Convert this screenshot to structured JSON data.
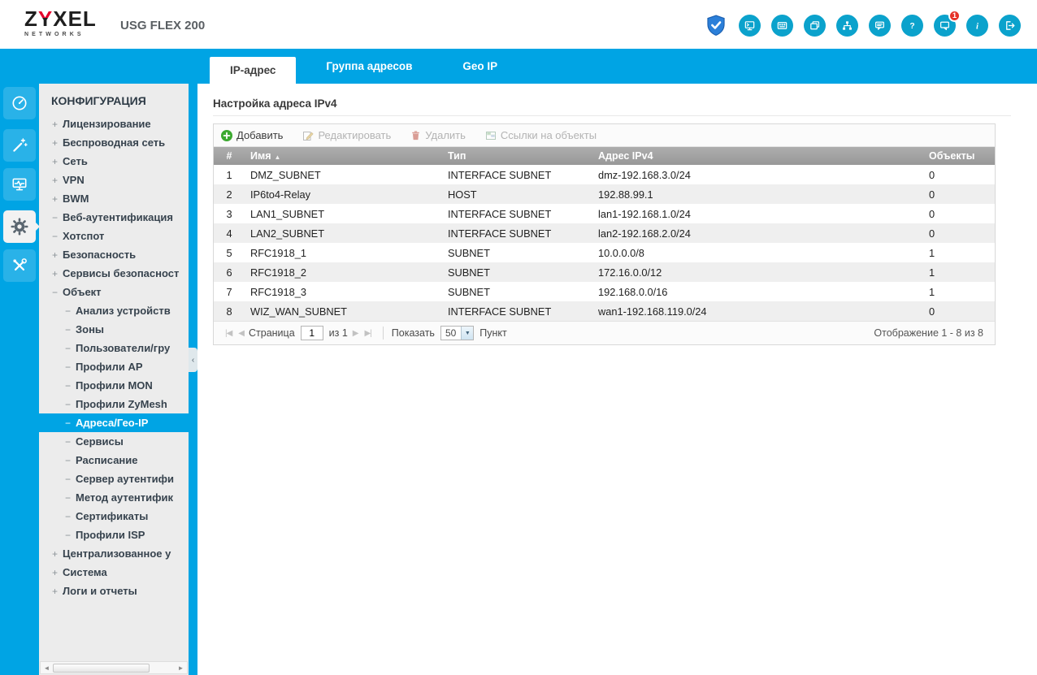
{
  "header": {
    "brand": {
      "z": "Z",
      "y": "Y",
      "rest": "XEL",
      "sub": "NETWORKS"
    },
    "product": "USG FLEX 200",
    "notification_badge": "1",
    "icon_names": [
      "shield-check-icon",
      "web-console-icon",
      "cli-icon",
      "reference-icon",
      "sitemap-icon",
      "forum-icon",
      "help-icon",
      "notification-icon",
      "info-icon",
      "logout-icon"
    ]
  },
  "colors": {
    "accent_cyan": "#00a4e4",
    "icon_teal": "#0ba2cc",
    "badge_red": "#e63329",
    "add_green": "#3ba92f"
  },
  "tabs": [
    {
      "label": "IP-адрес",
      "active": true
    },
    {
      "label": "Группа адресов",
      "active": false
    },
    {
      "label": "Geo IP",
      "active": false
    }
  ],
  "module_strip": {
    "icon_names": [
      "dashboard-icon",
      "wizard-icon",
      "monitor-icon",
      "configuration-gear-icon",
      "maintenance-icon"
    ],
    "active": "configuration-gear-icon"
  },
  "sidebar": {
    "title": "КОНФИГУРАЦИЯ",
    "items": [
      {
        "prefix": "+",
        "label": "Лицензирование",
        "level": 0,
        "active": false
      },
      {
        "prefix": "+",
        "label": "Беспроводная сеть",
        "level": 0,
        "active": false
      },
      {
        "prefix": "+",
        "label": "Сеть",
        "level": 0,
        "active": false
      },
      {
        "prefix": "+",
        "label": "VPN",
        "level": 0,
        "active": false
      },
      {
        "prefix": "+",
        "label": "BWM",
        "level": 0,
        "active": false
      },
      {
        "prefix": "−",
        "label": "Веб-аутентификация",
        "level": 0,
        "active": false
      },
      {
        "prefix": "−",
        "label": "Хотспот",
        "level": 0,
        "active": false
      },
      {
        "prefix": "+",
        "label": "Безопасность",
        "level": 0,
        "active": false
      },
      {
        "prefix": "+",
        "label": "Сервисы безопасност",
        "level": 0,
        "active": false
      },
      {
        "prefix": "−",
        "label": "Объект",
        "level": 0,
        "active": false
      },
      {
        "prefix": "−",
        "label": "Анализ устройств",
        "level": 1,
        "active": false
      },
      {
        "prefix": "−",
        "label": "Зоны",
        "level": 1,
        "active": false
      },
      {
        "prefix": "−",
        "label": "Пользователи/гру",
        "level": 1,
        "active": false
      },
      {
        "prefix": "−",
        "label": "Профили AP",
        "level": 1,
        "active": false
      },
      {
        "prefix": "−",
        "label": "Профили MON",
        "level": 1,
        "active": false
      },
      {
        "prefix": "−",
        "label": "Профили ZyMesh",
        "level": 1,
        "active": false
      },
      {
        "prefix": "−",
        "label": "Адреса/Гео-IP",
        "level": 1,
        "active": true
      },
      {
        "prefix": "−",
        "label": "Сервисы",
        "level": 1,
        "active": false
      },
      {
        "prefix": "−",
        "label": "Расписание",
        "level": 1,
        "active": false
      },
      {
        "prefix": "−",
        "label": "Сервер аутентифи",
        "level": 1,
        "active": false
      },
      {
        "prefix": "−",
        "label": "Метод аутентифик",
        "level": 1,
        "active": false
      },
      {
        "prefix": "−",
        "label": "Сертификаты",
        "level": 1,
        "active": false
      },
      {
        "prefix": "−",
        "label": "Профили ISP",
        "level": 1,
        "active": false
      },
      {
        "prefix": "+",
        "label": "Централизованное у",
        "level": 0,
        "active": false
      },
      {
        "prefix": "+",
        "label": "Система",
        "level": 0,
        "active": false
      },
      {
        "prefix": "+",
        "label": "Логи и отчеты",
        "level": 0,
        "active": false
      }
    ]
  },
  "main": {
    "section_title": "Настройка адреса IPv4",
    "toolbar": [
      {
        "label": "Добавить",
        "enabled": true,
        "icon": "add-plus-icon"
      },
      {
        "label": "Редактировать",
        "enabled": false,
        "icon": "edit-pencil-icon"
      },
      {
        "label": "Удалить",
        "enabled": false,
        "icon": "delete-trash-icon"
      },
      {
        "label": "Ссылки на объекты",
        "enabled": false,
        "icon": "object-references-icon"
      }
    ],
    "table": {
      "columns": [
        "#",
        "Имя",
        "Тип",
        "Адрес IPv4",
        "Объекты"
      ],
      "sort_column": "Имя",
      "sort_direction": "asc",
      "rows": [
        {
          "num": "1",
          "name": "DMZ_SUBNET",
          "type": "INTERFACE SUBNET",
          "address": "dmz-192.168.3.0/24",
          "objects": "0"
        },
        {
          "num": "2",
          "name": "IP6to4-Relay",
          "type": "HOST",
          "address": "192.88.99.1",
          "objects": "0"
        },
        {
          "num": "3",
          "name": "LAN1_SUBNET",
          "type": "INTERFACE SUBNET",
          "address": "lan1-192.168.1.0/24",
          "objects": "0"
        },
        {
          "num": "4",
          "name": "LAN2_SUBNET",
          "type": "INTERFACE SUBNET",
          "address": "lan2-192.168.2.0/24",
          "objects": "0"
        },
        {
          "num": "5",
          "name": "RFC1918_1",
          "type": "SUBNET",
          "address": "10.0.0.0/8",
          "objects": "1"
        },
        {
          "num": "6",
          "name": "RFC1918_2",
          "type": "SUBNET",
          "address": "172.16.0.0/12",
          "objects": "1"
        },
        {
          "num": "7",
          "name": "RFC1918_3",
          "type": "SUBNET",
          "address": "192.168.0.0/16",
          "objects": "1"
        },
        {
          "num": "8",
          "name": "WIZ_WAN_SUBNET",
          "type": "INTERFACE SUBNET",
          "address": "wan1-192.168.119.0/24",
          "objects": "0"
        }
      ]
    },
    "pagination": {
      "page_label": "Страница",
      "page_value": "1",
      "of_label": "из 1",
      "show_label": "Показать",
      "page_size": "50",
      "unit_label": "Пункт",
      "display_text": "Отображение 1 - 8 из 8"
    }
  },
  "icons": {
    "sort_asc": "▲",
    "first_page": "|◀",
    "prev_page": "◀",
    "next_page": "▶",
    "last_page": "▶|",
    "collapse": "‹",
    "scroll_left": "◄",
    "scroll_right": "►",
    "dropdown": "▼"
  }
}
